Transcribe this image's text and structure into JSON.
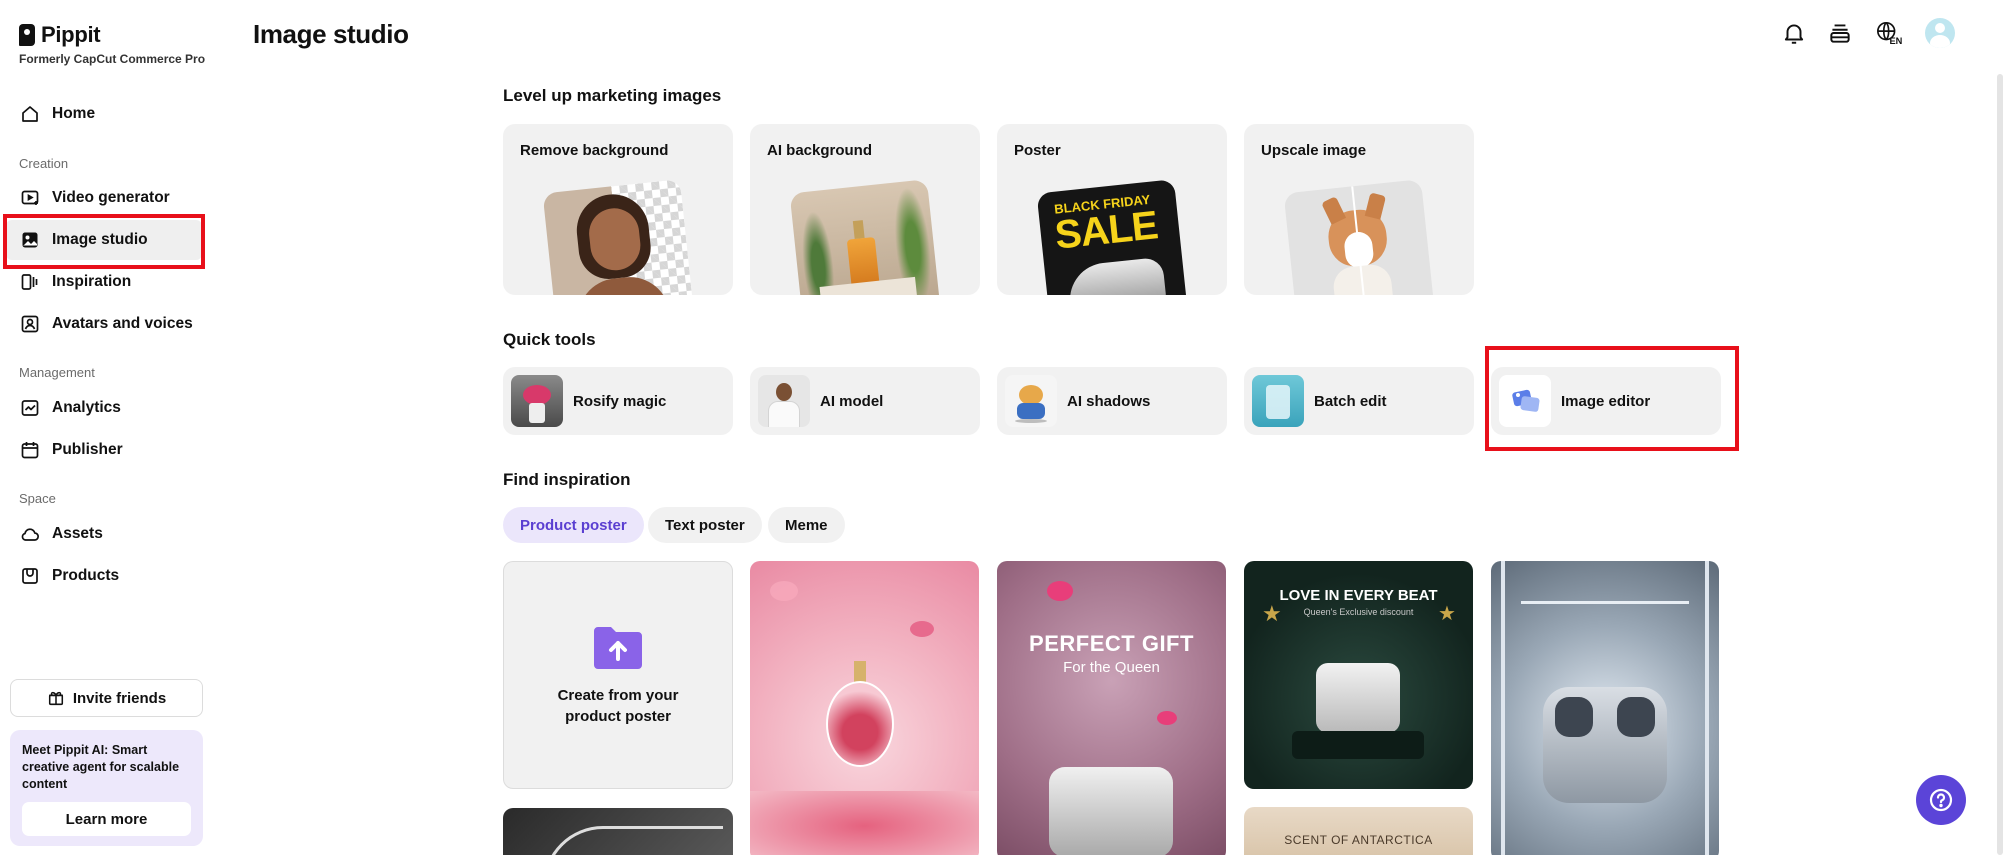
{
  "brand": {
    "name": "Pippit",
    "subtitle": "Formerly CapCut Commerce Pro"
  },
  "sidebar": {
    "home": "Home",
    "creation_label": "Creation",
    "video_generator": "Video generator",
    "image_studio": "Image studio",
    "inspiration": "Inspiration",
    "avatars": "Avatars and voices",
    "management_label": "Management",
    "analytics": "Analytics",
    "publisher": "Publisher",
    "space_label": "Space",
    "assets": "Assets",
    "products": "Products",
    "invite": "Invite friends",
    "promo_bold": "Meet Pippit AI:",
    "promo_text": " Smart creative agent for scalable content",
    "learn_more": "Learn more"
  },
  "header": {
    "title": "Image studio",
    "language": "EN"
  },
  "marketing": {
    "title": "Level up marketing images",
    "cards": [
      "Remove background",
      "AI background",
      "Poster",
      "Upscale image"
    ],
    "poster_text_1": "BLACK FRIDAY",
    "poster_text_2": "SALE"
  },
  "quick_tools": {
    "title": "Quick tools",
    "items": [
      "Rosify magic",
      "AI model",
      "AI shadows",
      "Batch edit",
      "Image editor"
    ]
  },
  "inspiration": {
    "title": "Find inspiration",
    "chips": [
      "Product poster",
      "Text poster",
      "Meme"
    ],
    "active_chip": "Product poster",
    "create_text": "Create from your product poster",
    "card_texts": {
      "perfect_gift": "PERFECT GIFT",
      "for_queen": "For the Queen",
      "love_beat": "LOVE IN EVERY BEAT",
      "love_sub": "Queen's Exclusive discount",
      "scent": "SCENT OF ANTARCTICA"
    }
  },
  "colors": {
    "accent": "#5b44d8",
    "highlight": "#e8101a",
    "card_bg": "#f1f1f1",
    "chip_active_bg": "#ebe6fb"
  }
}
